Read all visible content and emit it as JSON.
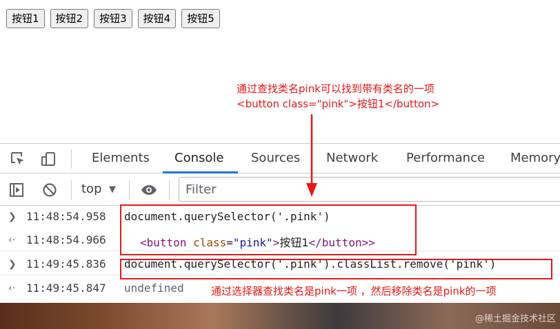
{
  "page": {
    "buttons": [
      "按钮1",
      "按钮2",
      "按钮3",
      "按钮4",
      "按钮5"
    ]
  },
  "annotations": {
    "top_line1": "通过查找类名pink可以找到带有类名的一项",
    "top_line2": "<button class=\"pink\">按钮1</button>",
    "bottom": "通过选择器查找类名是pink一项 ，然后移除类名是pink的一项"
  },
  "devtools": {
    "tabs": [
      "Elements",
      "Console",
      "Sources",
      "Network",
      "Performance",
      "Memory"
    ],
    "active_tab": "Console",
    "toolbar": {
      "context": "top",
      "filter_placeholder": "Filter"
    },
    "console": [
      {
        "timestamp": "11:48:54.958",
        "kind": "input",
        "text": "document.querySelector('.pink')"
      },
      {
        "timestamp": "11:48:54.966",
        "kind": "output",
        "tag_open": "<button",
        "attr_name": "class",
        "attr_value": "\"pink\"",
        "inner": "按钮1",
        "tag_close": "</button>"
      },
      {
        "timestamp": "11:49:45.836",
        "kind": "input",
        "text": "document.querySelector('.pink').classList.remove('pink')"
      },
      {
        "timestamp": "11:49:45.847",
        "kind": "output",
        "text": "undefined"
      }
    ]
  },
  "watermark": "@稀土掘金技术社区",
  "colors": {
    "annotation": "#e81717",
    "accent": "#1a73e8"
  }
}
